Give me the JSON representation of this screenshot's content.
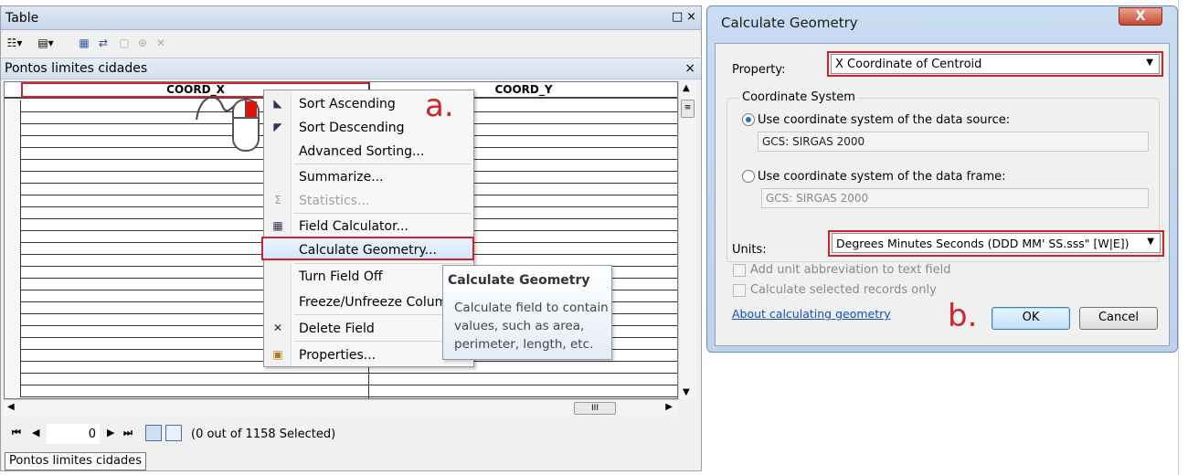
{
  "table_window": {
    "title": "Table",
    "restore_glyph": "□",
    "close_glyph": "×",
    "tab_title": "Pontos limites cidades",
    "tab_close_glyph": "×",
    "columns": [
      "COORD_X",
      "COORD_Y"
    ],
    "record_value": "0",
    "selection_status": "(0 out of 1158 Selected)",
    "bottom_tab": "Pontos limites cidades",
    "hscroll_grip": "III",
    "vscroll_grip": "≡",
    "toolbar_icons": [
      "table-options-icon",
      "related-tables-icon",
      "select-by-attributes-icon",
      "switch-selection-icon",
      "clear-selection-icon",
      "zoom-to-selected-icon",
      "delete-selected-icon"
    ]
  },
  "context_menu": {
    "items": [
      {
        "label": "Sort Ascending",
        "icon": "sort-ascending-icon",
        "enabled": true
      },
      {
        "label": "Sort Descending",
        "icon": "sort-descending-icon",
        "enabled": true
      },
      {
        "label": "Advanced Sorting...",
        "icon": "",
        "enabled": true
      },
      {
        "label": "Summarize...",
        "icon": "",
        "enabled": true
      },
      {
        "label": "Statistics...",
        "icon": "sigma-icon",
        "enabled": false
      },
      {
        "label": "Field Calculator...",
        "icon": "calculator-icon",
        "enabled": true
      },
      {
        "label": "Calculate Geometry...",
        "icon": "",
        "enabled": true,
        "highlighted": true
      },
      {
        "label": "Turn Field Off",
        "icon": "",
        "enabled": true
      },
      {
        "label": "Freeze/Unfreeze Column",
        "icon": "",
        "enabled": true
      },
      {
        "label": "Delete Field",
        "icon": "delete-icon",
        "enabled": true
      },
      {
        "label": "Properties...",
        "icon": "properties-icon",
        "enabled": true
      }
    ]
  },
  "tooltip": {
    "title": "Calculate Geometry",
    "body": "Calculate field to contain values, such as area, perimeter, length, etc."
  },
  "annotations": {
    "a": "a.",
    "b": "b."
  },
  "dialog": {
    "title": "Calculate Geometry",
    "close_glyph": "X",
    "property_label": "Property:",
    "property_value": "X Coordinate of Centroid",
    "coord_group_title": "Coordinate System",
    "radio_source_label": "Use coordinate system of the data source:",
    "radio_source_value": "GCS: SIRGAS 2000",
    "radio_frame_label": "Use coordinate system of the data frame:",
    "radio_frame_value": "GCS: SIRGAS 2000",
    "selected_radio": "source",
    "units_label": "Units:",
    "units_value": "Degrees Minutes Seconds (DDD MM' SS.sss\" [W|E])",
    "checkbox_abbrev": "Add unit abbreviation to text field",
    "checkbox_selected": "Calculate selected records only",
    "about_link": "About calculating geometry",
    "ok_label": "OK",
    "cancel_label": "Cancel"
  },
  "colors": {
    "highlight_red": "#d0242b",
    "link_blue": "#0b50c8",
    "title_gradient": "#c8d6ea"
  }
}
